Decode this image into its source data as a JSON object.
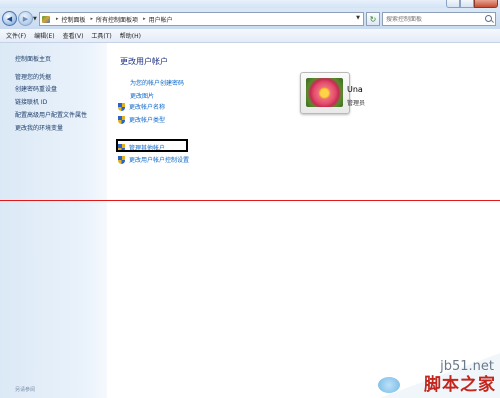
{
  "address_bar": {
    "segments": [
      "控制面板",
      "所有控制面板项",
      "用户帐户"
    ],
    "search_placeholder": "搜索控制面板"
  },
  "menu": [
    "文件(F)",
    "编辑(E)",
    "查看(V)",
    "工具(T)",
    "帮助(H)"
  ],
  "left_pane": {
    "items": [
      "控制面板主页",
      "管理您的凭据",
      "创建密码重设盘",
      "链接联机 ID",
      "配置高级用户配置文件属性",
      "更改我的环境变量"
    ],
    "see_also": "另请参阅"
  },
  "main": {
    "heading": "更改用户帐户",
    "links": [
      "为您的帐户创建密码",
      "更改图片"
    ],
    "shield_tasks": [
      "更改帐户名称",
      "更改帐户类型"
    ],
    "admin_tasks": [
      "管理其他帐户",
      "更改用户帐户控制设置"
    ]
  },
  "user": {
    "name": "Una",
    "role": "管理员"
  },
  "watermark": {
    "site": "jb51.net",
    "brand": "脚本之家"
  },
  "colors": {
    "link": "#0a66c9",
    "heading": "#1e3287",
    "annotation_line": "#e01919",
    "highlight_box": "#000000"
  }
}
